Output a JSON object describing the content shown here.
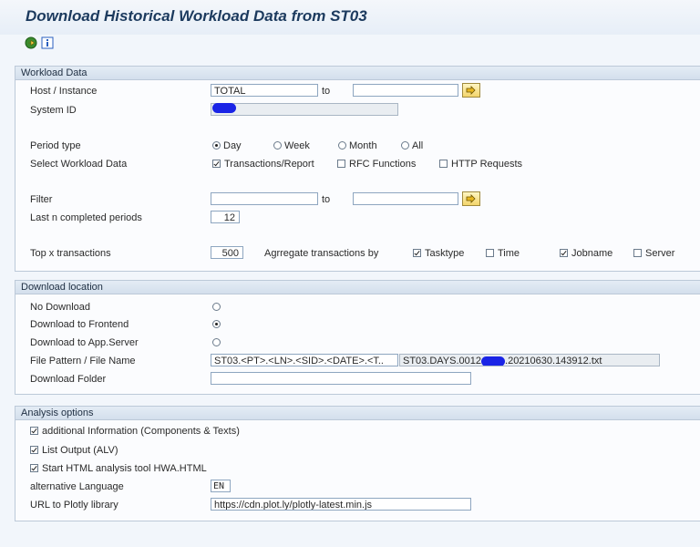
{
  "title": "Download Historical Workload Data from ST03",
  "toolbar": {
    "icons": [
      "execute-icon",
      "info-icon"
    ]
  },
  "workload": {
    "header": "Workload Data",
    "host_label": "Host / Instance",
    "host_from": "TOTAL",
    "to_label": "to",
    "host_to": "",
    "system_id_label": "System ID",
    "system_id": "",
    "period_type_label": "Period type",
    "period_options": [
      "Day",
      "Week",
      "Month",
      "All"
    ],
    "period_selected": "Day",
    "select_label": "Select Workload Data",
    "select_options": [
      {
        "label": "Transactions/Report",
        "checked": true
      },
      {
        "label": "RFC Functions",
        "checked": false
      },
      {
        "label": "HTTP Requests",
        "checked": false
      }
    ],
    "filter_label": "Filter",
    "filter_from": "",
    "filter_to_label": "to",
    "filter_to": "",
    "last_n_label": "Last n completed periods",
    "last_n": "12",
    "top_x_label": "Top x transactions",
    "top_x": "500",
    "aggregate_label": "Agrregate transactions by",
    "aggregate_options": [
      {
        "label": "Tasktype",
        "checked": true
      },
      {
        "label": "Time",
        "checked": false
      },
      {
        "label": "Jobname",
        "checked": true
      },
      {
        "label": "Server",
        "checked": false
      }
    ]
  },
  "download": {
    "header": "Download location",
    "options": [
      {
        "label": "No Download",
        "selected": false
      },
      {
        "label": "Download to Frontend",
        "selected": true
      },
      {
        "label": "Download to App.Server",
        "selected": false
      }
    ],
    "file_pattern_label": "File Pattern / File Name",
    "file_pattern": "ST03.<PT>.<LN>.<SID>.<DATE>.<T..",
    "file_name_prefix": "ST03.DAYS.0012",
    "file_name_suffix": ".20210630.143912.txt",
    "folder_label": "Download Folder",
    "folder": ""
  },
  "analysis": {
    "header": "Analysis options",
    "checks": [
      {
        "label": "additional Information (Components & Texts)",
        "checked": true
      },
      {
        "label": "List Output (ALV)",
        "checked": true
      },
      {
        "label": "Start HTML analysis tool HWA.HTML",
        "checked": true
      }
    ],
    "language_label": "alternative Language",
    "language": "EN",
    "url_label": "URL to Plotly library",
    "url": "https://cdn.plot.ly/plotly-latest.min.js"
  },
  "colors": {
    "title": "#1c3a5e",
    "accent": "#8ea6c0",
    "redaction": "#1a24e6"
  }
}
